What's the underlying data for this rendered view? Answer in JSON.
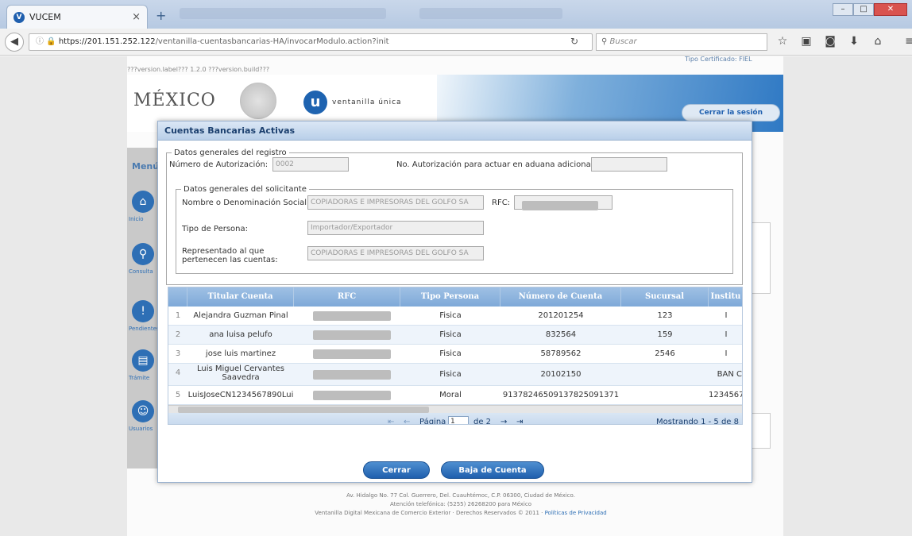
{
  "browser": {
    "tab_title": "VUCEM",
    "tab_icon": "vucem-icon",
    "url_host": "https://201.151.252.122",
    "url_path": "/ventanilla-cuentasbancarias-HA/invocarModulo.action?init",
    "search_placeholder": "Buscar"
  },
  "header": {
    "version": "???version.label??? 1.2.0 ???version.build???",
    "cert_label": "Tipo Certificado: FIEL",
    "mexico": "MÉXICO",
    "ventanilla_letter": "u",
    "ventanilla": "ventanilla única",
    "cerrar_sesion": "Cerrar la sesión"
  },
  "sidebar": {
    "title": "Menú",
    "items": [
      {
        "icon": "home-icon",
        "label": "Inicio"
      },
      {
        "icon": "search-icon",
        "label": "Consulta"
      },
      {
        "icon": "pending-icon",
        "label": "Pendientes"
      },
      {
        "icon": "tramite-icon",
        "label": "Trámite"
      },
      {
        "icon": "users-icon",
        "label": "Usuarios"
      }
    ]
  },
  "modal": {
    "title": "Cuentas Bancarias Activas",
    "registro_legend": "Datos generales del registro",
    "num_autorizacion_label": "Número de Autorización:",
    "num_autorizacion_value": "0002",
    "no_autorizacion_label": "No. Autorización para actuar en aduana adicional:",
    "no_autorizacion_value": "",
    "solicitante_legend": "Datos generales del solicitante",
    "nombre_label": "Nombre o Denominación Social:",
    "nombre_value": "COPIADORAS E IMPRESORAS DEL GOLFO SA",
    "rfc_label": "RFC:",
    "tipo_persona_label": "Tipo de Persona:",
    "tipo_persona_value": "Importador/Exportador",
    "representado_label": "Representado al que pertenecen las cuentas:",
    "representado_value": "COPIADORAS E IMPRESORAS DEL GOLFO SA",
    "columns": [
      "Titular Cuenta",
      "RFC",
      "Tipo Persona",
      "Número de Cuenta",
      "Sucursal",
      "Institu"
    ],
    "rows": [
      {
        "n": "1",
        "titular": "Alejandra Guzman Pinal",
        "tipo": "Fisica",
        "cuenta": "201201254",
        "sucursal": "123",
        "inst": "I"
      },
      {
        "n": "2",
        "titular": "ana luisa pelufo",
        "tipo": "Fisica",
        "cuenta": "832564",
        "sucursal": "159",
        "inst": "I"
      },
      {
        "n": "3",
        "titular": "jose luis martinez",
        "tipo": "Fisica",
        "cuenta": "58789562",
        "sucursal": "2546",
        "inst": "I"
      },
      {
        "n": "4",
        "titular": "Luis Miguel Cervantes Saavedra",
        "tipo": "Fisica",
        "cuenta": "20102150",
        "sucursal": "",
        "inst": "BAN C"
      },
      {
        "n": "5",
        "titular": "LuisJoseCN1234567890Lui",
        "tipo": "Moral",
        "cuenta": "91378246509137825091371",
        "sucursal": "",
        "inst": "1234567"
      }
    ],
    "pager": {
      "pagina_label": "Página",
      "pagina_value": "1",
      "of_label": "de 2",
      "mostrando": "Mostrando 1 - 5 de 8"
    },
    "cerrar_button": "Cerrar",
    "baja_button": "Baja de Cuenta"
  },
  "footer": {
    "line1": "Av. Hidalgo No. 77 Col. Guerrero, Del. Cuauhtémoc, C.P. 06300, Ciudad de México.",
    "line2": "Atención telefónica: (5255) 26268200 para México",
    "line3": "Ventanilla Digital Mexicana de Comercio Exterior · Derechos Reservados © 2011 · ",
    "privacy": "Políticas de Privacidad"
  }
}
